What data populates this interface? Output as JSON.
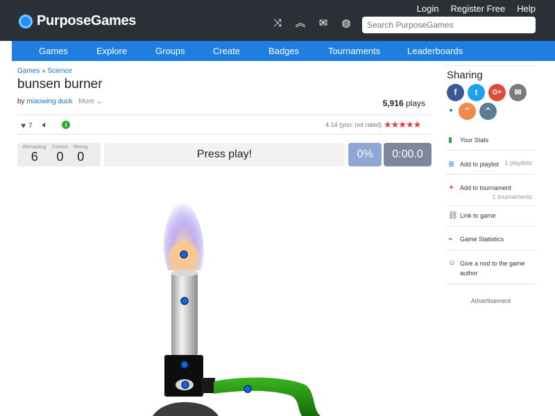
{
  "header": {
    "logo_text": "PurposeGames",
    "links": [
      "Login",
      "Register Free",
      "Help"
    ],
    "search_placeholder": "Search PurposeGames",
    "icons": [
      "shuffle-icon",
      "chevrons-up-icon",
      "mail-icon",
      "globe-icon"
    ]
  },
  "nav": [
    "Games",
    "Explore",
    "Groups",
    "Create",
    "Badges",
    "Tournaments",
    "Leaderboards"
  ],
  "breadcrumb": {
    "games": "Games",
    "sep": "»",
    "category": "Science"
  },
  "game": {
    "title": "bunsen burner",
    "by": "by",
    "author": "miaowing duck",
    "more": "More",
    "plays_count": "5,916",
    "plays_label": "plays",
    "likes": "7",
    "rating_text": "4.14 (you: not rated)",
    "stars": "★★★★★"
  },
  "score": {
    "remaining_label": "Remaining",
    "remaining": "6",
    "correct_label": "Correct",
    "correct": "0",
    "wrong_label": "Wrong",
    "wrong": "0",
    "press_play": "Press play!",
    "percent": "0%",
    "timer": "0:00.0"
  },
  "sidebar": {
    "sharing_title": "Sharing",
    "share_buttons": [
      {
        "name": "facebook",
        "glyph": "f",
        "color": "#3b5998"
      },
      {
        "name": "twitter",
        "glyph": "t",
        "color": "#1da1f2"
      },
      {
        "name": "google-plus",
        "glyph": "G+",
        "color": "#dd4b39"
      },
      {
        "name": "email",
        "glyph": "✉",
        "color": "#7a7a7a"
      },
      {
        "name": "embed",
        "glyph": "⌃",
        "color": "#f08a4b"
      },
      {
        "name": "purpose",
        "glyph": "⌃",
        "color": "#5b7c92"
      }
    ],
    "items": [
      {
        "label": "Your Stats",
        "sub": ""
      },
      {
        "label": "Add to playlist",
        "sub": "1 playlists"
      },
      {
        "label": "Add to tournament",
        "sub": "1 tournaments"
      },
      {
        "label": "Link to game",
        "sub": ""
      },
      {
        "label": "Game Statistics",
        "sub": ""
      },
      {
        "label": "Give a nod to the game author",
        "sub": ""
      }
    ],
    "advertisement": "Advertisement"
  },
  "colors": {
    "topbar": "#2b2f36",
    "nav": "#1f7fe0",
    "link": "#1a6fc7",
    "star": "#e53935",
    "pin": "#1565e6"
  }
}
